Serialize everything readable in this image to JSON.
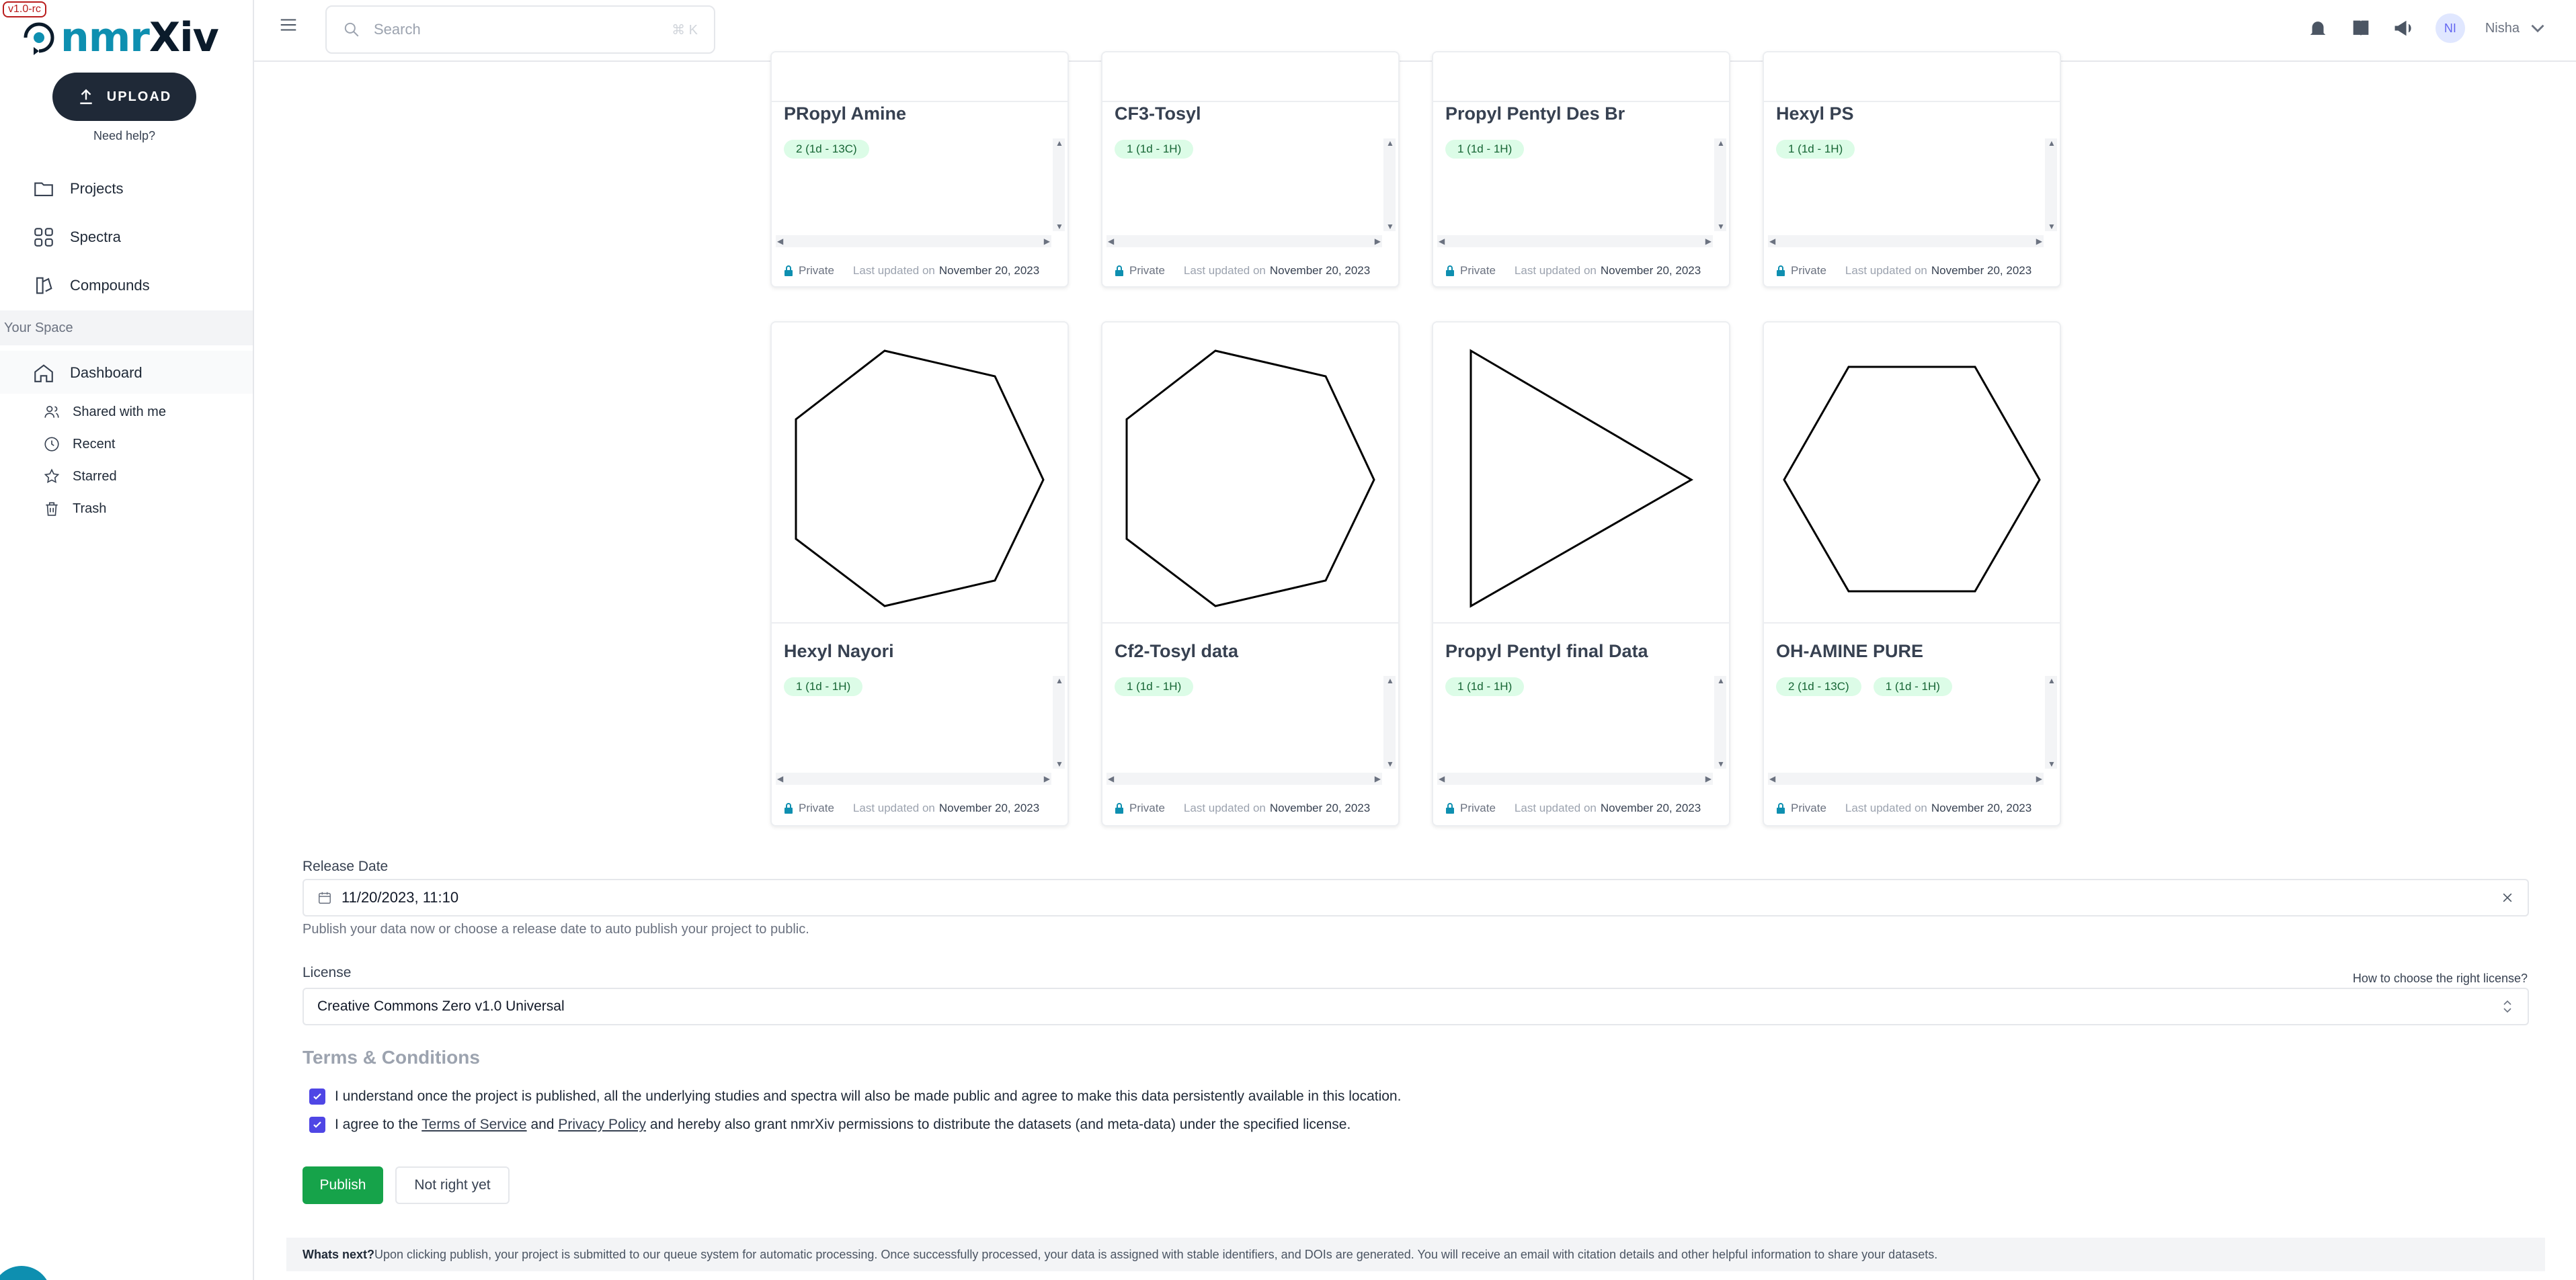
{
  "app": {
    "version": "v1.0-rc",
    "logo_part1": "nmr",
    "logo_part2": "Xiv",
    "upload_label": "UPLOAD",
    "need_help": "Need help?"
  },
  "sidebar": {
    "nav": [
      {
        "label": "Projects",
        "icon": "folder-icon"
      },
      {
        "label": "Spectra",
        "icon": "grid-icon"
      },
      {
        "label": "Compounds",
        "icon": "compound-icon"
      }
    ],
    "your_space": "Your Space",
    "dashboard": "Dashboard",
    "sub": [
      {
        "label": "Shared with me",
        "icon": "users-icon"
      },
      {
        "label": "Recent",
        "icon": "clock-icon"
      },
      {
        "label": "Starred",
        "icon": "star-icon"
      },
      {
        "label": "Trash",
        "icon": "trash-icon"
      }
    ]
  },
  "topbar": {
    "search_placeholder": "Search",
    "shortcut": "⌘ K",
    "avatar_initials": "NI",
    "user_name": "Nisha"
  },
  "cards": [
    {
      "title": "PRopyl Amine",
      "badges": [
        "2 (1d - 13C)"
      ],
      "status": "Private",
      "updated_prefix": "Last updated on",
      "updated": "November 20, 2023"
    },
    {
      "title": "CF3-Tosyl",
      "badges": [
        "1 (1d - 1H)"
      ],
      "status": "Private",
      "updated_prefix": "Last updated on",
      "updated": "November 20, 2023"
    },
    {
      "title": "Propyl Pentyl Des Br",
      "badges": [
        "1 (1d - 1H)"
      ],
      "status": "Private",
      "updated_prefix": "Last updated on",
      "updated": "November 20, 2023"
    },
    {
      "title": "Hexyl PS",
      "badges": [
        "1 (1d - 1H)"
      ],
      "status": "Private",
      "updated_prefix": "Last updated on",
      "updated": "November 20, 2023"
    },
    {
      "title": "Hexyl Nayori",
      "badges": [
        "1 (1d - 1H)"
      ],
      "status": "Private",
      "updated_prefix": "Last updated on",
      "updated": "November 20, 2023",
      "structure": "heptagon"
    },
    {
      "title": "Cf2-Tosyl data",
      "badges": [
        "1 (1d - 1H)"
      ],
      "status": "Private",
      "updated_prefix": "Last updated on",
      "updated": "November 20, 2023",
      "structure": "heptagon"
    },
    {
      "title": "Propyl Pentyl final Data",
      "badges": [
        "1 (1d - 1H)"
      ],
      "status": "Private",
      "updated_prefix": "Last updated on",
      "updated": "November 20, 2023",
      "structure": "triangle"
    },
    {
      "title": "OH-AMINE PURE",
      "badges": [
        "2 (1d - 13C)",
        "1 (1d - 1H)"
      ],
      "status": "Private",
      "updated_prefix": "Last updated on",
      "updated": "November 20, 2023",
      "structure": "hexagon"
    }
  ],
  "form": {
    "release_label": "Release Date",
    "release_value": "11/20/2023, 11:10",
    "release_help": "Publish your data now or choose a release date to auto publish your project to public.",
    "license_label": "License",
    "license_link": "How to choose the right license?",
    "license_value": "Creative Commons Zero v1.0 Universal",
    "terms_heading": "Terms & Conditions",
    "check1": "I understand once the project is published, all the underlying studies and spectra will also be made public and agree to make this data persistently available in this location.",
    "check2_a": "I agree to the",
    "check2_tos": "Terms of Service",
    "check2_and": "and",
    "check2_pp": "Privacy Policy",
    "check2_b": "and hereby also grant nmrXiv permissions to distribute the datasets (and meta-data) under the specified license.",
    "publish": "Publish",
    "not_yet": "Not right yet",
    "whats_next_label": "Whats next?",
    "whats_next_text": "Upon clicking publish, your project is submitted to our queue system for automatic processing. Once successfully processed, your data is assigned with stable identifiers, and DOIs are generated. You will receive an email with citation details and other helpful information to share your datasets."
  },
  "colors": {
    "brand": "#0e8fb0",
    "publish": "#16a34a",
    "checkbox": "#4f46e5",
    "badge_bg": "#dcfce7"
  }
}
